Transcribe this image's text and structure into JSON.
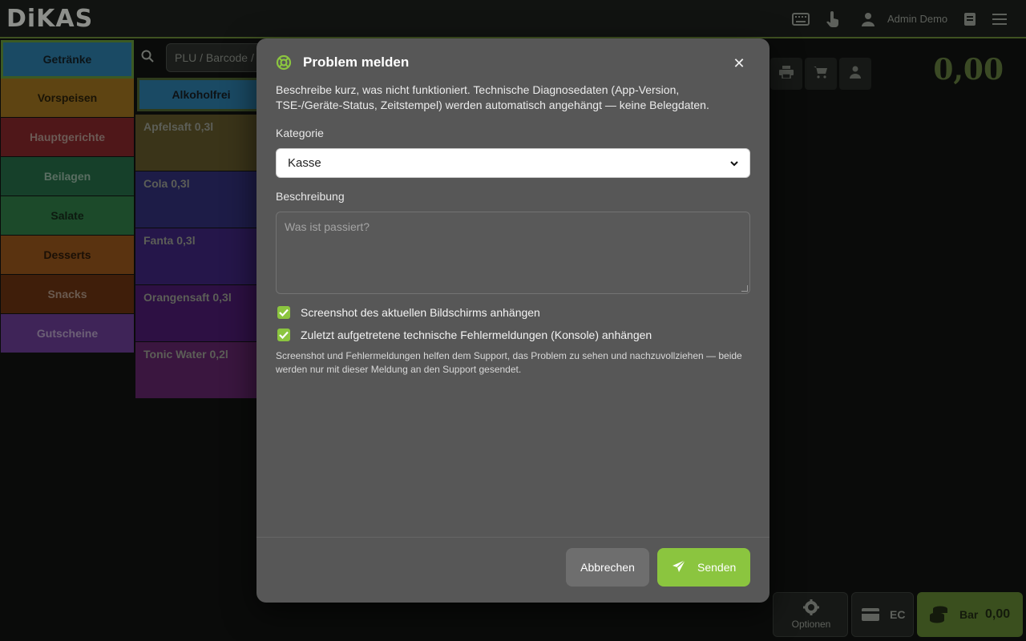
{
  "app": {
    "logo": "DiKAS",
    "user_name": "Admin Demo"
  },
  "search": {
    "placeholder": "PLU / Barcode /"
  },
  "categories": [
    {
      "label": "Getränke",
      "bg": "#1a4a64",
      "fg": "#0c1418",
      "selected": true
    },
    {
      "label": "Vorspeisen",
      "bg": "#5e4412",
      "fg": "#1a1406"
    },
    {
      "label": "Hauptgerichte",
      "bg": "#4f1719",
      "fg": "#6b5a55"
    },
    {
      "label": "Beilagen",
      "bg": "#16402a",
      "fg": "#5a6e62"
    },
    {
      "label": "Salate",
      "bg": "#1c4a2a",
      "fg": "#0d1a10"
    },
    {
      "label": "Desserts",
      "bg": "#5a3310",
      "fg": "#1b1006"
    },
    {
      "label": "Snacks",
      "bg": "#3f1e0a",
      "fg": "#6a5a4f"
    },
    {
      "label": "Gutscheine",
      "bg": "#3f2458",
      "fg": "#6c6076"
    }
  ],
  "subcategory": {
    "label": "Alkoholfrei"
  },
  "products": [
    {
      "name": "Apfelsaft 0,3l",
      "bg": "#3a3419"
    },
    {
      "name": "Cola 0,3l",
      "bg": "#1d1c47"
    },
    {
      "name": "Fanta 0,3l",
      "bg": "#25164a"
    },
    {
      "name": "Orangensaft 0,3l",
      "bg": "#2d1043"
    },
    {
      "name": "Tonic Water 0,2l",
      "bg": "#3a163f"
    }
  ],
  "total": "0,00",
  "bottom": {
    "options_label": "Optionen",
    "ec_label": "EC",
    "bar_label": "Bar",
    "bar_amount": "0,00"
  },
  "modal": {
    "title": "Problem melden",
    "description": "Beschreibe kurz, was nicht funktioniert. Technische Diagnosedaten (App-Version, TSE-/Geräte-Status, Zeitstempel) werden automatisch angehängt — keine Belegdaten.",
    "category_label": "Kategorie",
    "category_value": "Kasse",
    "description_label": "Beschreibung",
    "textarea_placeholder": "Was ist passiert?",
    "check_screenshot": "Screenshot des aktuellen Bildschirms anhängen",
    "check_console": "Zuletzt aufgetretene technische Fehlermeldungen (Konsole) anhängen",
    "hint": "Screenshot und Fehlermeldungen helfen dem Support, das Problem zu sehen und nachzuvollziehen — beide werden nur mit dieser Meldung an den Support gesendet.",
    "cancel_label": "Abbrechen",
    "send_label": "Senden",
    "accent": "#8bc53f"
  }
}
